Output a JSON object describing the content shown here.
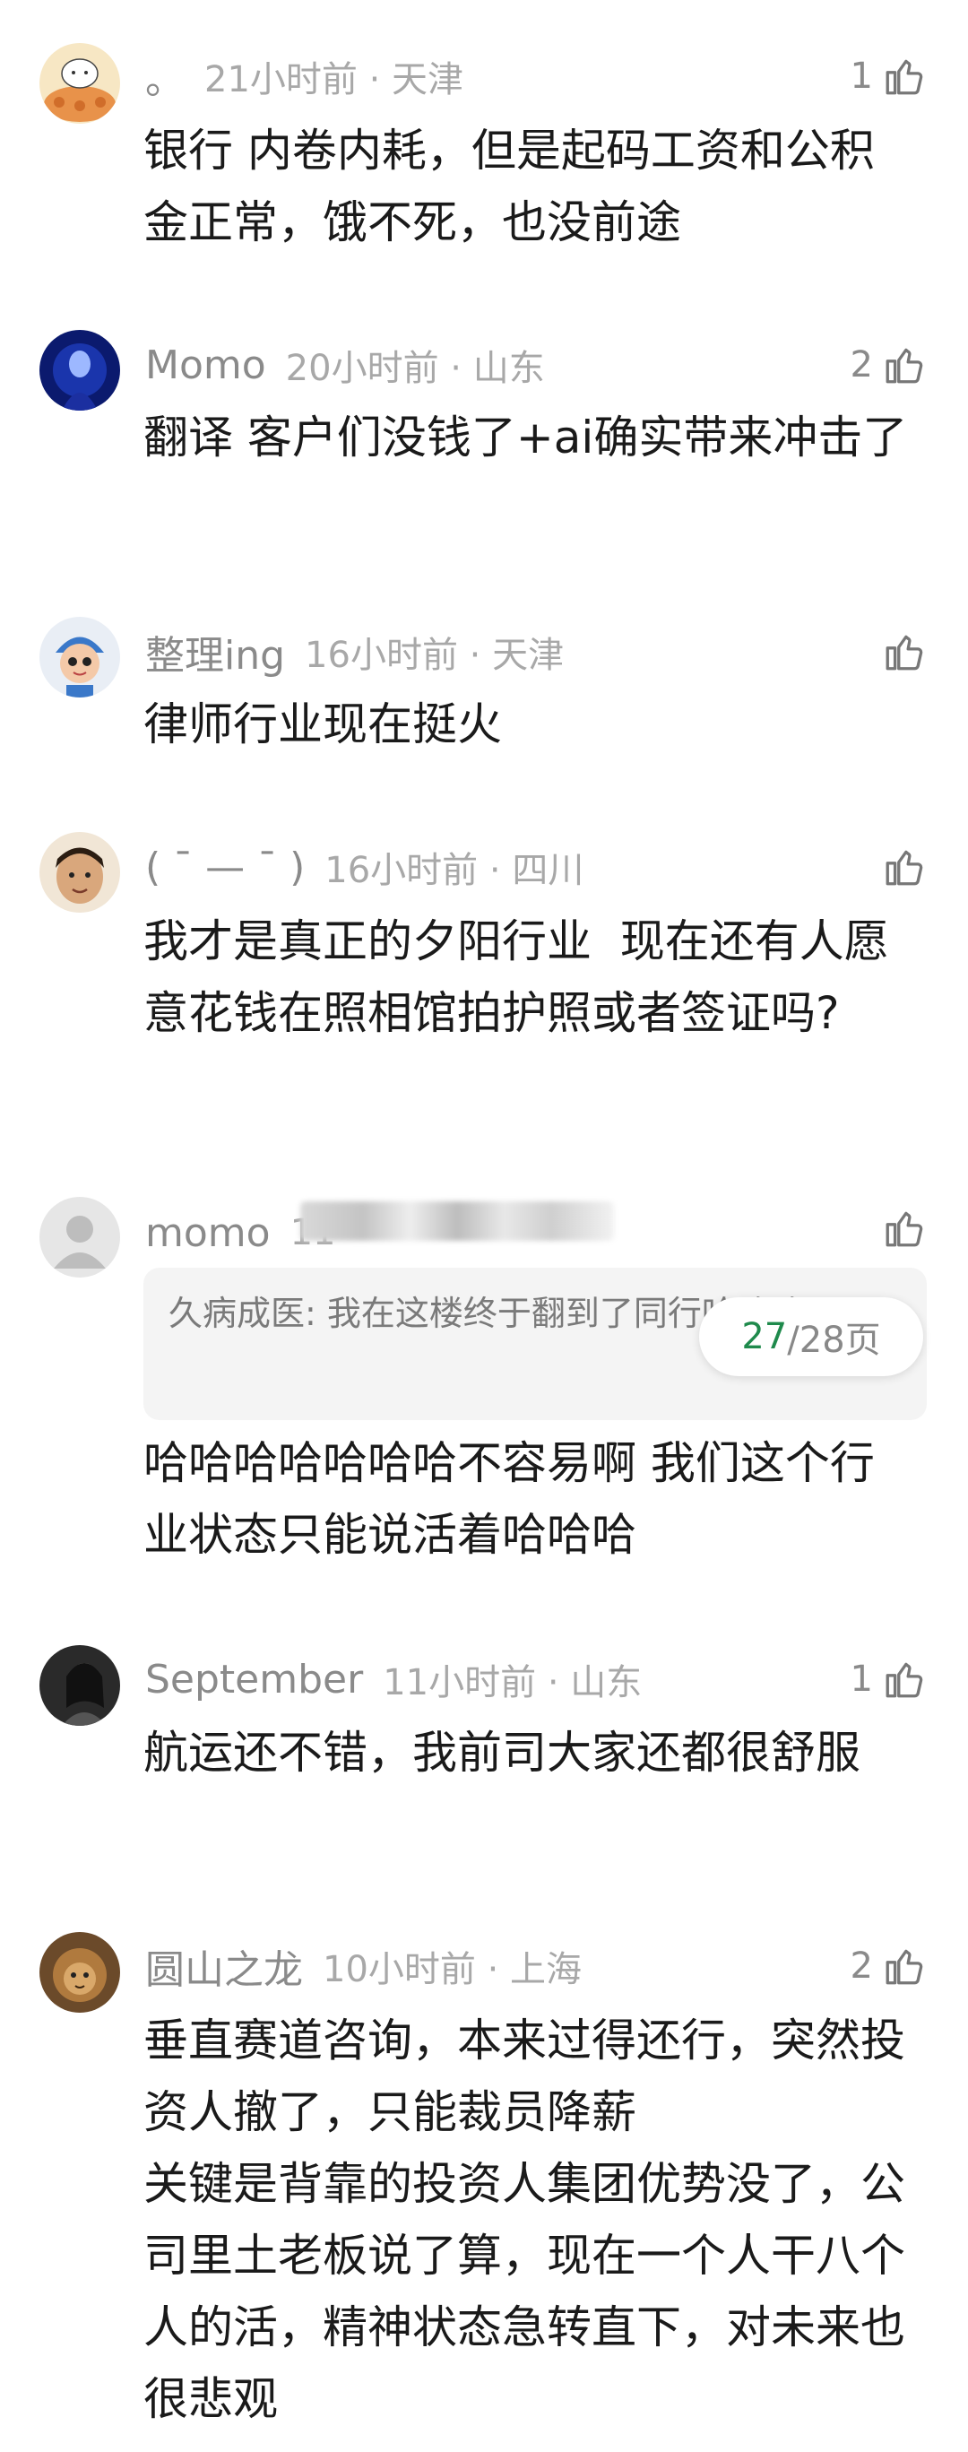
{
  "comments": [
    {
      "name": "。",
      "time": "21小时前 · 天津",
      "likes": "1",
      "text": "银行 内卷内耗，但是起码工资和公积金正常，饿不死，也没前途"
    },
    {
      "name": "Momo",
      "time": "20小时前 · 山东",
      "likes": "2",
      "text": "翻译 客户们没钱了+ai确实带来冲击了"
    },
    {
      "name": "整理ing",
      "time": "16小时前 · 天津",
      "likes": "",
      "text": "律师行业现在挺火"
    },
    {
      "name": "( ¯ — ¯ )",
      "time": "16小时前 · 四川",
      "likes": "",
      "text": "我才是真正的夕阳行业  现在还有人愿意花钱在照相馆拍护照或者签证吗?"
    },
    {
      "name": "momo",
      "time": "11",
      "likes": "",
      "text": "哈哈哈哈哈哈哈不容易啊 我们这个行业状态只能说活着哈哈哈"
    },
    {
      "name": "September",
      "time": "11小时前 · 山东",
      "likes": "1",
      "text": "航运还不错，我前司大家还都很舒服"
    },
    {
      "name": "圆山之龙",
      "time": "10小时前 · 上海",
      "likes": "2",
      "text": "垂直赛道咨询，本来过得还行，突然投资人撤了，只能裁员降薪\n关键是背靠的投资人集团优势没了，公司里土老板说了算，现在一个人干八个人的活，精神状态急转直下，对未来也很悲观"
    }
  ],
  "quote": {
    "text": "久病成医: 我在这楼终于翻到了同行哈哈哈"
  },
  "pager": {
    "current": "27",
    "total": "/28页"
  },
  "colors": {
    "accent_green": "#1f8a4c",
    "meta_gray": "#8a8a8a"
  }
}
